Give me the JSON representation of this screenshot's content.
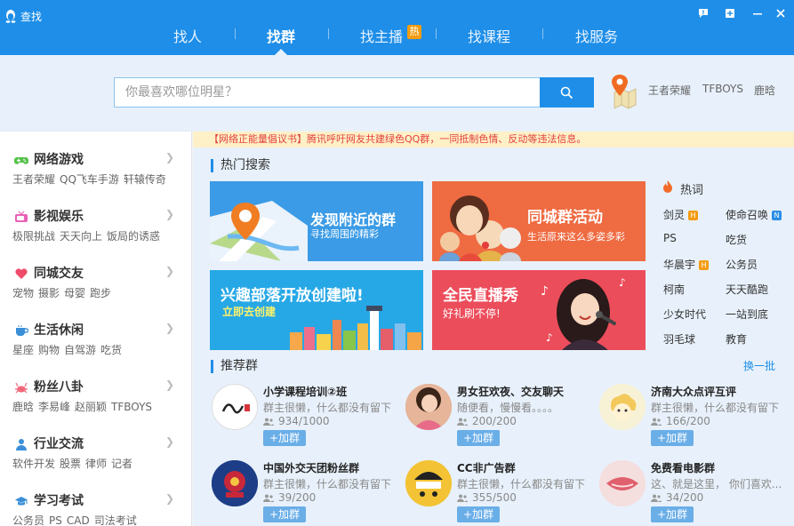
{
  "window": {
    "title": "查找"
  },
  "nav": {
    "tabs": [
      {
        "label": "找人"
      },
      {
        "label": "找群"
      },
      {
        "label": "找主播",
        "badge": "热"
      },
      {
        "label": "找课程"
      },
      {
        "label": "找服务"
      }
    ],
    "active_tab": "找群"
  },
  "search": {
    "placeholder": "你最喜欢哪位明星？",
    "quick_links": [
      "王者荣耀",
      "TFBOYS",
      "鹿晗"
    ]
  },
  "sidebar": {
    "items": [
      {
        "title": "网络游戏",
        "icon": "gamepad-icon",
        "tags": [
          "王者荣耀",
          "QQ飞车手游",
          "轩辕传奇"
        ]
      },
      {
        "title": "影视娱乐",
        "icon": "tv-icon",
        "tags": [
          "极限挑战",
          "天天向上",
          "饭局的诱惑"
        ]
      },
      {
        "title": "同城交友",
        "icon": "heart-icon",
        "tags": [
          "宠物",
          "摄影",
          "母婴",
          "跑步"
        ]
      },
      {
        "title": "生活休闲",
        "icon": "coffee-cup-icon",
        "tags": [
          "星座",
          "购物",
          "自驾游",
          "吃货"
        ]
      },
      {
        "title": "粉丝八卦",
        "icon": "crab-icon",
        "tags": [
          "鹿晗",
          "李易峰",
          "赵丽颖",
          "TFBOYS"
        ]
      },
      {
        "title": "行业交流",
        "icon": "person-icon",
        "tags": [
          "软件开发",
          "股票",
          "律师",
          "记者"
        ]
      },
      {
        "title": "学习考试",
        "icon": "graduation-cap-icon",
        "tags": [
          "公务员",
          "PS",
          "CAD",
          "司法考试"
        ]
      }
    ]
  },
  "notice": {
    "text": "【网络正能量倡议书】腾讯呼吁网友共建绿色QQ群，一同抵制色情、反动等违法信息。"
  },
  "hot_search": {
    "title": "热门搜索",
    "banners": [
      {
        "title": "发现附近的群",
        "subtitle": "寻找周围的精彩"
      },
      {
        "title": "同城群活动",
        "subtitle": "生活原来这么多姿多彩"
      },
      {
        "title": "兴趣部落开放创建啦!",
        "subtitle": "立即去创建"
      },
      {
        "title": "全民直播秀",
        "subtitle": "好礼刷不停!"
      }
    ],
    "hotwords_title": "热词",
    "hotwords": [
      {
        "text": "剑灵",
        "badge": "H"
      },
      {
        "text": "使命召唤",
        "badge": "N"
      },
      {
        "text": "PS"
      },
      {
        "text": "吃货"
      },
      {
        "text": "华晨宇",
        "badge": "H"
      },
      {
        "text": "公务员"
      },
      {
        "text": "柯南"
      },
      {
        "text": "天天酷跑"
      },
      {
        "text": "少女时代"
      },
      {
        "text": "一站到底"
      },
      {
        "text": "羽毛球"
      },
      {
        "text": "教育"
      }
    ]
  },
  "recommended": {
    "title": "推荐群",
    "refresh_label": "换一批",
    "join_label": "+加群",
    "groups": [
      {
        "name": "小学课程培训②班",
        "desc": "群主很懒，什么都没有留下",
        "members": "934/1000"
      },
      {
        "name": "男女狂欢夜、交友聊天",
        "desc": "随便看，慢慢看。。。。",
        "members": "200/200"
      },
      {
        "name": "济南大众点评互评",
        "desc": "群主很懒，什么都没有留下",
        "members": "166/200"
      },
      {
        "name": "中国外交天团粉丝群",
        "desc": "群主很懒，什么都没有留下",
        "members": "39/200"
      },
      {
        "name": "CC非广告群",
        "desc": "群主很懒，什么都没有留下",
        "members": "355/500"
      },
      {
        "name": "免费看电影群",
        "desc": "这、就是这里， 你们喜欢...",
        "members": "34/200"
      }
    ]
  },
  "colors": {
    "brand_blue": "#1e8ee8",
    "panel_bg": "#e8f1fb",
    "notice_text": "#e2413b",
    "notice_bg": "#fef0c7",
    "hot_orange": "#f39c12"
  }
}
